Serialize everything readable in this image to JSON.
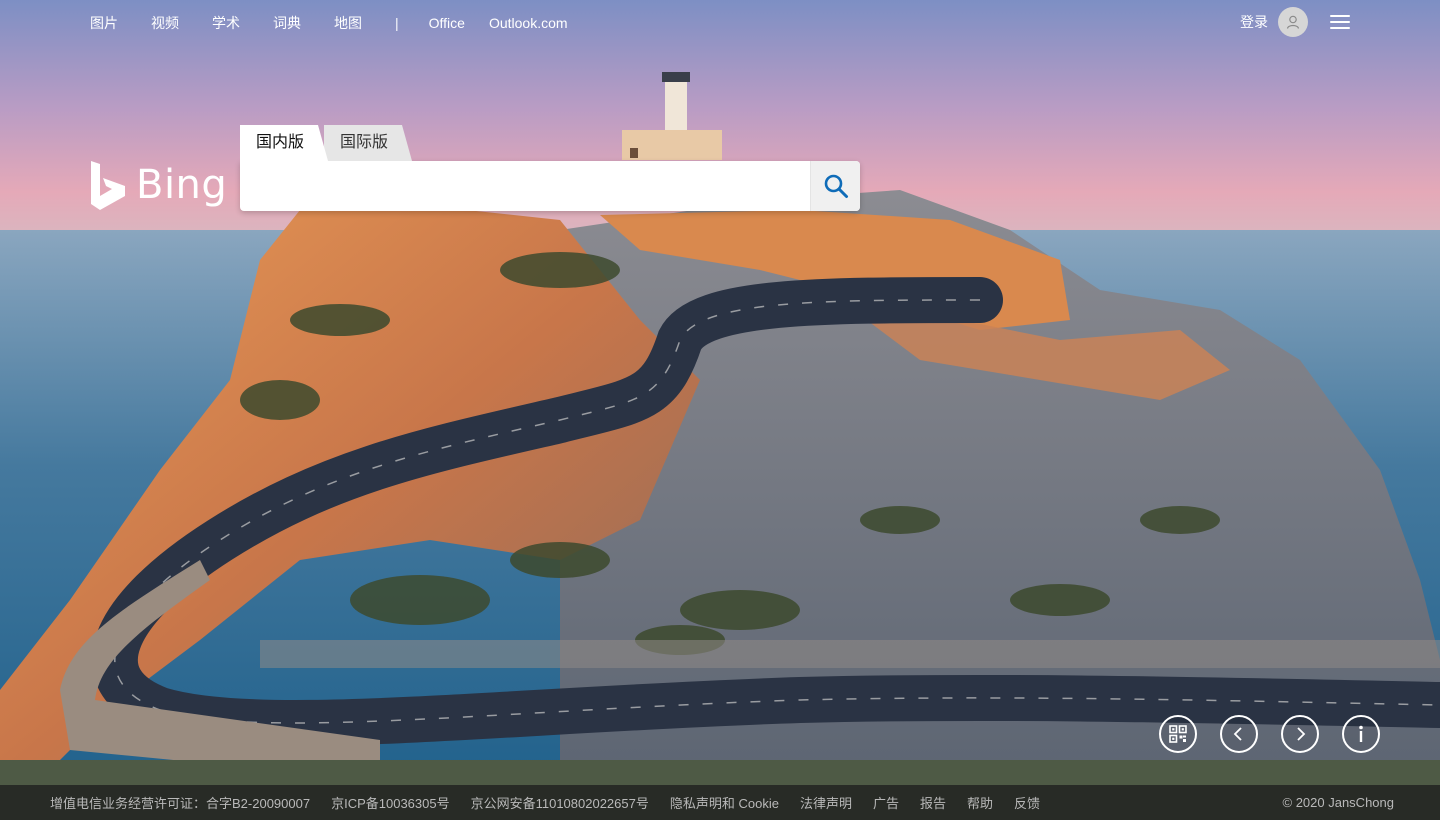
{
  "nav": {
    "links": [
      "图片",
      "视频",
      "学术",
      "词典",
      "地图"
    ],
    "separator": "|",
    "external": [
      "Office",
      "Outlook.com"
    ]
  },
  "account": {
    "login_label": "登录",
    "avatar_icon": "user-icon",
    "menu_icon": "hamburger-menu-icon"
  },
  "logo": {
    "text": "Bing",
    "icon": "bing-logo-icon"
  },
  "search": {
    "tabs": [
      "国内版",
      "国际版"
    ],
    "active_tab": "国内版",
    "query": "",
    "button_icon": "search-icon",
    "accent_color": "#0f6cb8"
  },
  "controls": [
    "qr-code-icon",
    "chevron-left-icon",
    "chevron-right-icon",
    "info-icon"
  ],
  "footer": {
    "links": [
      "增值电信业务经营许可证：合字B2-20090007",
      "京ICP备10036305号",
      "京公网安备11010802022657号",
      "隐私声明和 Cookie",
      "法律声明",
      "广告",
      "报告",
      "帮助",
      "反馈"
    ],
    "copyright": "© 2020 JansChong"
  }
}
